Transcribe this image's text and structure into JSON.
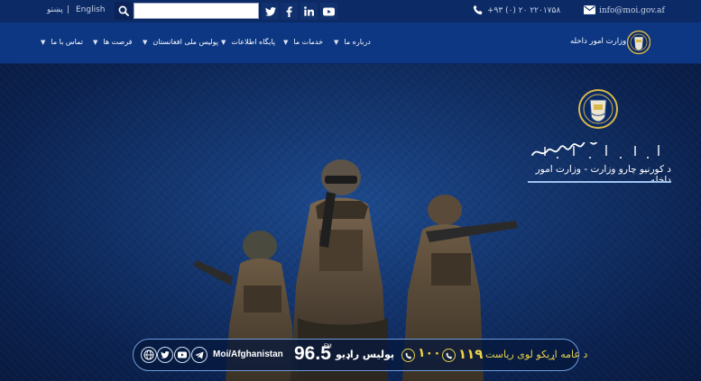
{
  "topbar": {
    "lang_pashto": "پښتو",
    "lang_separator": "|",
    "lang_english": "English",
    "search": {
      "value": "",
      "placeholder": ""
    },
    "social": {
      "twitter": "twitter-icon",
      "facebook": "facebook-icon",
      "linkedin": "linkedin-icon",
      "youtube": "youtube-icon"
    },
    "phone": "+۹۳ (۰) ۲۰ ۲۲۰۱۷۵۸",
    "email": "info@moi.gov.af"
  },
  "nav": {
    "items": [
      {
        "label": "درباره ما"
      },
      {
        "label": "خدمات ما"
      },
      {
        "label": "پایگاه اطلاعات"
      },
      {
        "label": "پولیس ملی افغانستان"
      },
      {
        "label": "فرصت ها"
      },
      {
        "label": "تماس با ما"
      }
    ],
    "ministry_title": "وزارت امور داخله"
  },
  "hero": {
    "subtitle": "د کورنیو چارو وزارت - وزارت امور داخله"
  },
  "radio_banner": {
    "handle": "Moi/Afghanistan",
    "fm_label": "FM",
    "frequency": "96.5",
    "radio_name": "پولیس راډیو",
    "hotline_100": "۱۰۰",
    "hotline_119": "۱۱۹",
    "caption": "د عامه اړیکو لوی ریاست"
  },
  "colors": {
    "topbar_bg": "#0c2a66",
    "nav_bg": "#0d3783",
    "accent_yellow": "#e9d24a"
  }
}
